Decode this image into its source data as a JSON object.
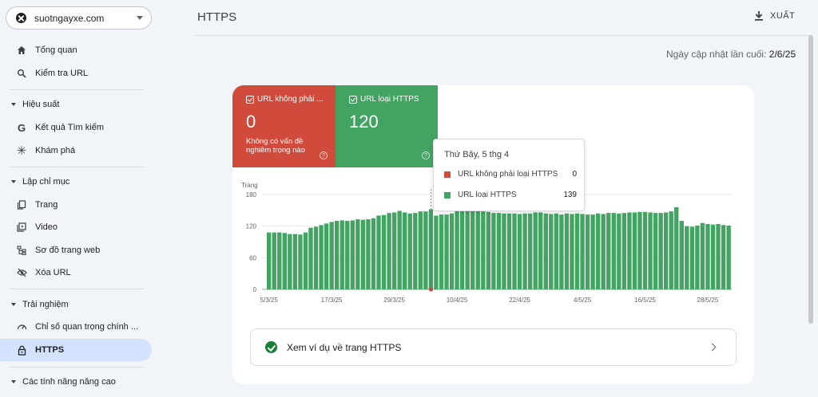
{
  "property": {
    "domain": "suotngayxe.com"
  },
  "nav": {
    "overview": "Tổng quan",
    "url_inspection": "Kiểm tra URL",
    "performance_section": "Hiệu suất",
    "search_results": "Kết quả Tìm kiếm",
    "discover": "Khám phá",
    "indexing_section": "Lập chỉ mục",
    "pages": "Trang",
    "video": "Video",
    "sitemaps": "Sơ đồ trang web",
    "removals": "Xóa URL",
    "experience_section": "Trải nghiệm",
    "core_web_vitals": "Chỉ số quan trọng chính ...",
    "https": "HTTPS",
    "enhancements_section": "Các tính năng nâng cao"
  },
  "header": {
    "title": "HTTPS",
    "export_label": "XUẤT",
    "updated_label": "Ngày cập nhật lần cuối:",
    "updated_value": "2/6/25"
  },
  "tiles": {
    "non_https": {
      "label": "URL không phải ...",
      "count": "0",
      "note": "Không có vấn đề nghiêm trọng nào",
      "color": "#d14b3c"
    },
    "https": {
      "label": "URL loại HTTPS",
      "count": "120",
      "color": "#43a362"
    }
  },
  "tooltip": {
    "title": "Thứ Bảy, 5 thg 4",
    "rows": [
      {
        "label": "URL không phải loại HTTPS",
        "value": "0",
        "color": "#d14b3c"
      },
      {
        "label": "URL loại HTTPS",
        "value": "139",
        "color": "#43a362"
      }
    ]
  },
  "chart_data": {
    "type": "bar",
    "ylabel": "Trang",
    "ylim": [
      0,
      180
    ],
    "yticks": [
      "0",
      "60",
      "120",
      "180"
    ],
    "xticks": [
      "5/3/25",
      "17/3/25",
      "29/3/25",
      "10/4/25",
      "22/4/25",
      "4/5/25",
      "16/5/25",
      "28/5/25"
    ],
    "series": [
      {
        "name": "URL loại HTTPS",
        "color": "#43a362",
        "values": [
          108,
          108,
          108,
          107,
          105,
          105,
          104,
          108,
          117,
          119,
          122,
          125,
          128,
          130,
          131,
          130,
          131,
          133,
          132,
          133,
          135,
          140,
          141,
          145,
          146,
          149,
          146,
          144,
          145,
          148,
          148,
          152,
          140,
          142,
          142,
          144,
          150,
          151,
          152,
          152,
          151,
          148,
          147,
          145,
          145,
          144,
          144,
          144,
          143,
          144,
          144,
          146,
          146,
          144,
          143,
          144,
          142,
          144,
          143,
          144,
          143,
          142,
          142,
          144,
          143,
          145,
          145,
          144,
          145,
          146,
          146,
          147,
          147,
          146,
          145,
          145,
          146,
          148,
          156,
          130,
          120,
          119,
          121,
          126,
          124,
          123,
          124,
          122,
          121
        ]
      },
      {
        "name": "URL không phải loại HTTPS",
        "color": "#d14b3c",
        "values": [
          0
        ]
      }
    ],
    "highlight": {
      "x": "5/4/25"
    }
  },
  "example": {
    "label": "Xem ví dụ về trang HTTPS"
  }
}
